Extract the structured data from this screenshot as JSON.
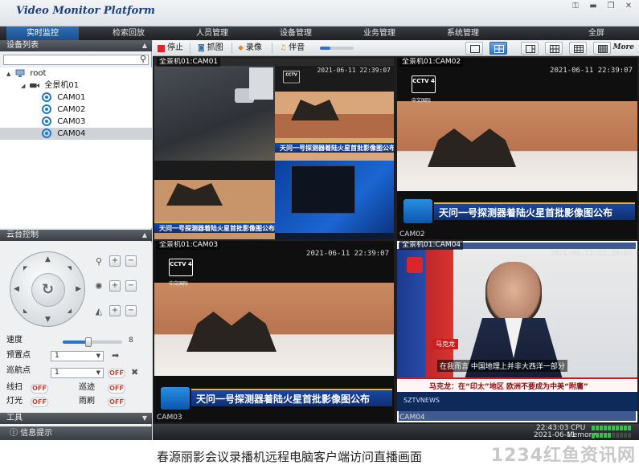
{
  "app": {
    "title": "Video Monitor Platform",
    "window_controls": [
      "key-icon",
      "minimize-icon",
      "restore-icon",
      "close-icon"
    ]
  },
  "menu": {
    "items": [
      "实时监控",
      "检索回放",
      "人员管理",
      "设备管理",
      "业务管理",
      "系统管理",
      "全屏"
    ],
    "active": "实时监控"
  },
  "device_list": {
    "header": "设备列表",
    "search_placeholder": "",
    "tree": {
      "root": "root",
      "group": "全景机01",
      "cameras": [
        "CAM01",
        "CAM02",
        "CAM03",
        "CAM04"
      ],
      "selected": "CAM04"
    }
  },
  "ptz": {
    "header": "云台控制",
    "speed_label": "速度",
    "speed_value": "8",
    "speed_fraction": 0.43,
    "preset_label": "预置点",
    "preset_value": "1",
    "cruise_label": "巡航点",
    "cruise_value": "1",
    "cruise_toggle": "OFF",
    "line_scan_label": "线扫",
    "line_scan_toggle": "OFF",
    "patrol_label": "巡迹",
    "patrol_toggle": "OFF",
    "light_label": "灯光",
    "light_toggle": "OFF",
    "wiper_label": "雨刷",
    "wiper_toggle": "OFF",
    "icons": [
      "zoom-icon",
      "focus-icon",
      "iris-icon"
    ]
  },
  "tools": {
    "header": "工具"
  },
  "info": {
    "label": "信息提示"
  },
  "toolbar": {
    "stop_label": "停止",
    "snapshot_label": "抓图",
    "record_label": "录像",
    "audio_label": "伴音",
    "volume_fraction": 0.3,
    "more_label": "More"
  },
  "panes": [
    {
      "title": "全景机01:CAM01",
      "bottom": "",
      "timestamp": "",
      "sub_timestamp": "2021-06-11 22:39:07",
      "sub_caption": "天问一号探测器着陆火星首批影像图公布"
    },
    {
      "title": "全景机01:CAM02",
      "bottom": "CAM02",
      "timestamp": "2021-06-11 22:39:07",
      "channel": "CCTV 4",
      "channel_sub": "中文国际",
      "caption": "天问一号探测器着陆火星首批影像图公布"
    },
    {
      "title": "全景机01:CAM03",
      "bottom": "CAM03",
      "timestamp": "2021-06-11 22:39:07",
      "channel": "CCTV 4",
      "channel_sub": "中文国际",
      "caption": "天问一号探测器着陆火星首批影像图公布"
    },
    {
      "title": "全景机01:CAM04",
      "bottom": "CAM04",
      "timestamp": "2021-06-11 22:39:07",
      "speaker_tag": "马克龙",
      "subtitle": "在我而言  中国地理上并非大西洋一部分",
      "lower_third": "马克龙：在“印太”地区 欧洲不要成为中美“附庸”",
      "ticker": "SZTVNEWS"
    }
  ],
  "statusbar": {
    "time": "22:43:03",
    "cpu_label": "CPU",
    "cpu_level": 1.0,
    "date": "2021-06-11",
    "memory_label": "Memory",
    "memory_level": 0.5
  },
  "page_caption": "春源丽影会议录播机远程电脑客户端访问直播画面",
  "watermark": "1234红鱼资讯网",
  "colors": {
    "menu_active": "#2f73c7",
    "caption_blue": "#1a47a3",
    "caption_gold": "#e7b128",
    "off_red": "#d13b2b",
    "cam_icon_blue": "#1f78c8"
  }
}
